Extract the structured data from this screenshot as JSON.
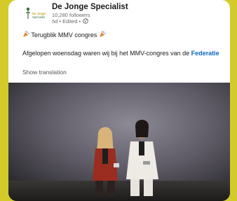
{
  "colors": {
    "background": "#d3cb2a",
    "card": "#ffffff",
    "link": "#0a66c2"
  },
  "post": {
    "org_name": "De Jonge Specialist",
    "followers": "10,280 followers",
    "meta": "5d • Edited •",
    "globe_icon": "globe-icon",
    "logo_text_line1": "De Jonge",
    "logo_text_line2": "Specialist",
    "title_emoji_icon": "party-popper-icon",
    "title": "Terugblik MMV congres",
    "text_prefix": "Afgelopen woensdag waren wij bij het MMV-congres van de ",
    "text_link": "Federatie",
    "show_translation": "Show translation"
  }
}
